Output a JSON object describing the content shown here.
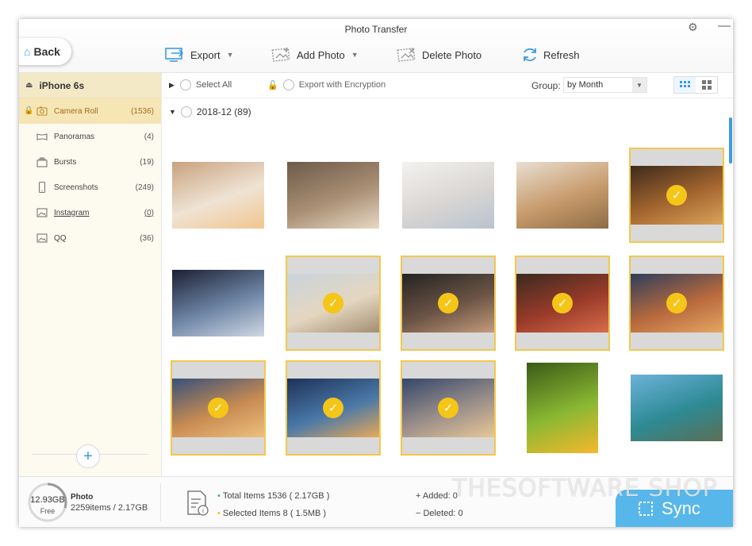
{
  "window": {
    "title": "Photo Transfer"
  },
  "nav": {
    "back_label": "Back"
  },
  "toolbar": {
    "export_label": "Export",
    "add_photo_label": "Add Photo",
    "delete_photo_label": "Delete Photo",
    "refresh_label": "Refresh"
  },
  "sidebar": {
    "device_name": "iPhone 6s",
    "items": [
      {
        "label": "Camera Roll",
        "count": "(1536)",
        "icon": "camera-icon",
        "active": true
      },
      {
        "label": "Panoramas",
        "count": "(4)",
        "icon": "panorama-icon"
      },
      {
        "label": "Bursts",
        "count": "(19)",
        "icon": "bursts-icon"
      },
      {
        "label": "Screenshots",
        "count": "(249)",
        "icon": "phone-icon"
      },
      {
        "label": "Instagram",
        "count": "(0)",
        "icon": "image-icon"
      },
      {
        "label": "QQ",
        "count": "(36)",
        "icon": "image-icon"
      }
    ]
  },
  "filter_bar": {
    "select_all_label": "Select All",
    "encryption_label": "Export with Encryption",
    "group_label": "Group:",
    "group_value": "by Month"
  },
  "group": {
    "title": "2018-12 (89)"
  },
  "photos": [
    {
      "name": "kitten-on-blanket",
      "selected": false,
      "colors": [
        "#c9a27f",
        "#efe3d4",
        "#f1c58e"
      ]
    },
    {
      "name": "tabby-cat-closeup",
      "selected": false,
      "colors": [
        "#6d5a49",
        "#a98f74",
        "#e7d8c4"
      ]
    },
    {
      "name": "white-kitten",
      "selected": false,
      "colors": [
        "#f4f2f0",
        "#d9d6d3",
        "#b9c3cf"
      ]
    },
    {
      "name": "breakfast-table",
      "selected": false,
      "colors": [
        "#e9dfd2",
        "#c79a6b",
        "#8e6c46"
      ]
    },
    {
      "name": "food-platter",
      "selected": true,
      "colors": [
        "#3d2a1c",
        "#a5662f",
        "#d9a35c"
      ]
    },
    {
      "name": "woman-in-dark-light",
      "selected": false,
      "colors": [
        "#1c2033",
        "#6f86a6",
        "#cfd8e3"
      ]
    },
    {
      "name": "woman-on-beach",
      "selected": true,
      "colors": [
        "#c9d4dc",
        "#e4d6c0",
        "#a38e71"
      ]
    },
    {
      "name": "woman-in-cap",
      "selected": true,
      "colors": [
        "#232323",
        "#6b5445",
        "#c49b7c"
      ]
    },
    {
      "name": "woman-in-red",
      "selected": true,
      "colors": [
        "#3b2a1f",
        "#9a3b2a",
        "#d86d4a"
      ]
    },
    {
      "name": "city-bridge-dusk",
      "selected": true,
      "colors": [
        "#2d3e5c",
        "#b8693d",
        "#e5a663"
      ]
    },
    {
      "name": "florence-skyline",
      "selected": true,
      "colors": [
        "#36517a",
        "#c98b52",
        "#ecc07e"
      ]
    },
    {
      "name": "river-bridge-night",
      "selected": true,
      "colors": [
        "#1d3157",
        "#4a78a8",
        "#e8a958"
      ]
    },
    {
      "name": "prague-square",
      "selected": true,
      "colors": [
        "#34476a",
        "#9b8f8a",
        "#e7c796"
      ]
    },
    {
      "name": "sunset-meadow",
      "selected": false,
      "colors": [
        "#3a5a17",
        "#8ab833",
        "#f5b82c"
      ]
    },
    {
      "name": "lake-mountains",
      "selected": false,
      "colors": [
        "#6cb2d9",
        "#2d8a94",
        "#5c6f55"
      ]
    },
    {
      "name": "partial-row-1",
      "selected": false,
      "colors": [
        "#5fa8d8",
        "#9fc8e4",
        "#e9eef2"
      ]
    },
    {
      "name": "partial-row-2",
      "selected": false,
      "colors": [
        "#2f4f7f",
        "#5a86b8",
        "#c9d7e6"
      ]
    },
    {
      "name": "partial-row-3",
      "selected": false,
      "colors": [
        "#4b86c2",
        "#a0c4e6",
        "#e2eaf2"
      ]
    },
    {
      "name": "partial-row-4",
      "selected": false,
      "colors": [
        "#3f7b3a",
        "#7fb05e",
        "#c9dfb0"
      ]
    },
    {
      "name": "partial-row-5",
      "selected": false,
      "colors": [
        "#6d8fbc",
        "#a4bfdc",
        "#e8eef5"
      ]
    }
  ],
  "status": {
    "storage_size": "12.93GB",
    "storage_free_label": "Free",
    "storage_used_fraction": 0.3,
    "media_type": "Photo",
    "media_summary": "2259items / 2.17GB",
    "total_items": "Total Items 1536 ( 2.17GB )",
    "selected_items": "Selected Items 8 ( 1.5MB )",
    "added": "Added: 0",
    "deleted": "Deleted: 0",
    "sync_label": "Sync"
  },
  "watermark": "THESOFTWARE SHOP",
  "colors": {
    "accent": "#3a9be0",
    "selection": "#f2c94c",
    "check": "#f5c518",
    "sidebar_active": "#f6e6b5"
  }
}
